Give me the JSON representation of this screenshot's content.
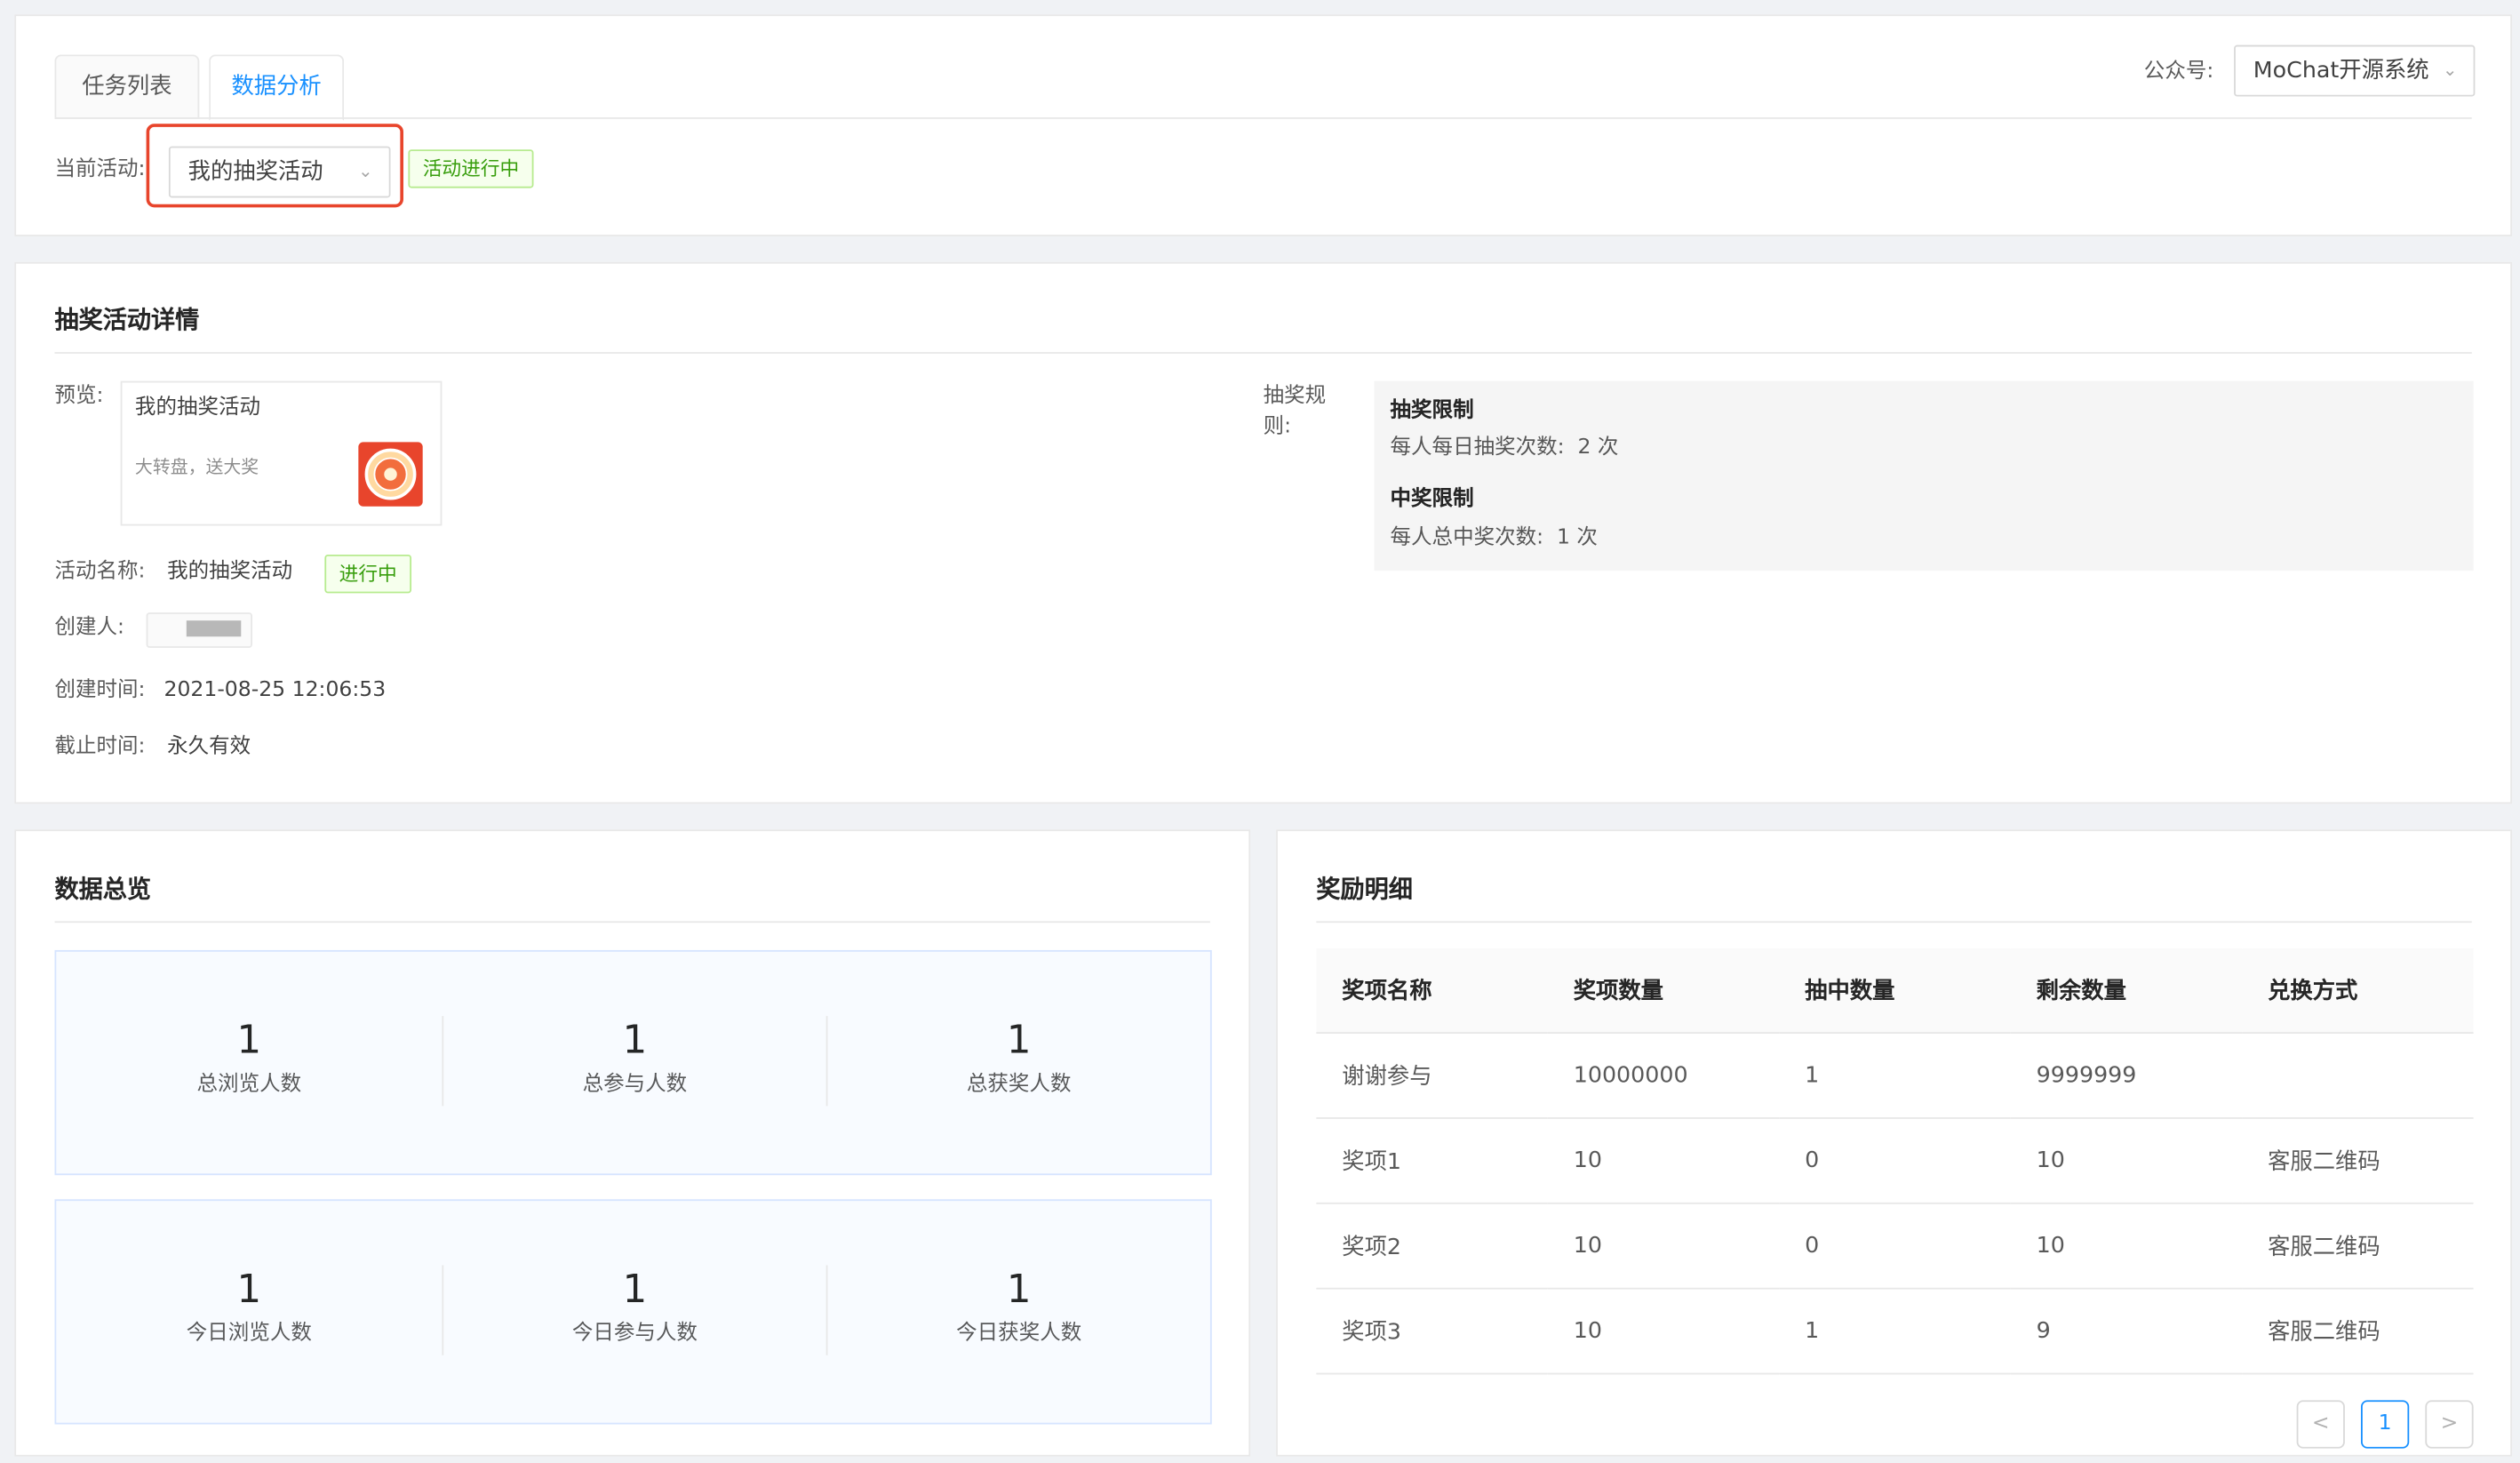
{
  "tabs": [
    {
      "label": "任务列表",
      "active": false
    },
    {
      "label": "数据分析",
      "active": true
    }
  ],
  "account": {
    "label": "公众号:",
    "value": "MoChat开源系统"
  },
  "current": {
    "label": "当前活动:",
    "value": "我的抽奖活动",
    "status": "活动进行中"
  },
  "detail": {
    "title": "抽奖活动详情",
    "preview_label": "预览:",
    "preview": {
      "title": "我的抽奖活动",
      "desc": "大转盘，送大奖"
    },
    "name_label": "活动名称:",
    "name_value": "我的抽奖活动",
    "name_status": "进行中",
    "creator_label": "创建人:",
    "created_label": "创建时间:",
    "created_value": "2021-08-25 12:06:53",
    "deadline_label": "截止时间:",
    "deadline_value": "永久有效",
    "rules_label": "抽奖规则:",
    "rules": [
      {
        "title": "抽奖限制",
        "text": "每人每日抽奖次数:  2 次"
      },
      {
        "title": "中奖限制",
        "text": "每人总中奖次数:  1 次"
      }
    ]
  },
  "overview": {
    "title": "数据总览",
    "total": [
      {
        "value": "1",
        "label": "总浏览人数"
      },
      {
        "value": "1",
        "label": "总参与人数"
      },
      {
        "value": "1",
        "label": "总获奖人数"
      }
    ],
    "today": [
      {
        "value": "1",
        "label": "今日浏览人数"
      },
      {
        "value": "1",
        "label": "今日参与人数"
      },
      {
        "value": "1",
        "label": "今日获奖人数"
      }
    ]
  },
  "prizes": {
    "title": "奖励明细",
    "columns": [
      "奖项名称",
      "奖项数量",
      "抽中数量",
      "剩余数量",
      "兑换方式"
    ],
    "rows": [
      [
        "谢谢参与",
        "10000000",
        "1",
        "9999999",
        ""
      ],
      [
        "奖项1",
        "10",
        "0",
        "10",
        "客服二维码"
      ],
      [
        "奖项2",
        "10",
        "0",
        "10",
        "客服二维码"
      ],
      [
        "奖项3",
        "10",
        "1",
        "9",
        "客服二维码"
      ]
    ],
    "pagination": {
      "current": "1",
      "prev": "<",
      "next": ">"
    }
  },
  "colors": {
    "primary": "#1890ff",
    "success": "#389e0d",
    "highlight": "#e8452c"
  }
}
